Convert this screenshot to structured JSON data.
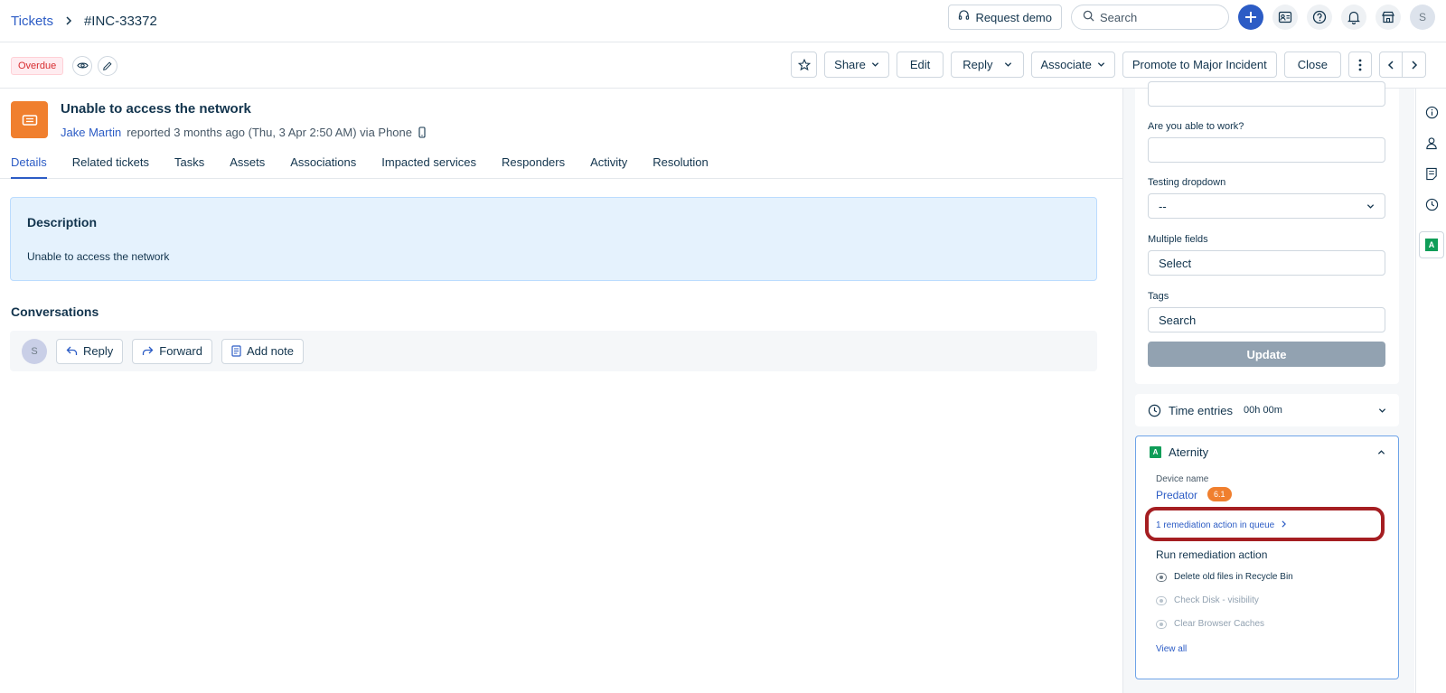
{
  "header": {
    "breadcrumb_root": "Tickets",
    "ticket_id": "#INC-33372",
    "request_demo": "Request demo",
    "search_placeholder": "Search",
    "avatar_initial": "S"
  },
  "actionbar": {
    "status_badge": "Overdue",
    "buttons": {
      "share": "Share",
      "edit": "Edit",
      "reply": "Reply",
      "associate": "Associate",
      "promote": "Promote to Major Incident",
      "close": "Close"
    }
  },
  "ticket": {
    "subject": "Unable to access the network",
    "reporter": "Jake Martin",
    "reported_text": "reported 3 months ago (Thu, 3 Apr 2:50 AM) via Phone"
  },
  "tabs": [
    "Details",
    "Related tickets",
    "Tasks",
    "Assets",
    "Associations",
    "Impacted services",
    "Responders",
    "Activity",
    "Resolution"
  ],
  "description": {
    "title": "Description",
    "text": "Unable to access the network"
  },
  "conversations": {
    "title": "Conversations",
    "avatar_initial": "S",
    "reply": "Reply",
    "forward": "Forward",
    "add_note": "Add note"
  },
  "right_panel": {
    "fields": {
      "able_to_work_label": "Are you able to work?",
      "testing_dropdown_label": "Testing dropdown",
      "testing_dropdown_value": "--",
      "multiple_fields_label": "Multiple fields",
      "multiple_fields_value": "Select",
      "tags_label": "Tags",
      "tags_placeholder": "Search"
    },
    "update_button": "Update",
    "time_entries": {
      "label": "Time entries",
      "value": "00h 00m"
    },
    "aternity": {
      "logo_letter": "A",
      "title": "Aternity",
      "device_label": "Device name",
      "device_name": "Predator",
      "device_score": "6.1",
      "queue_link": "1 remediation action in queue",
      "run_title": "Run remediation action",
      "actions": [
        {
          "label": "Delete old files in Recycle Bin",
          "enabled": true
        },
        {
          "label": "Check Disk - visibility",
          "enabled": false
        },
        {
          "label": "Clear Browser Caches",
          "enabled": false
        }
      ],
      "view_all": "View all"
    }
  },
  "rail": {
    "active_letter": "A"
  },
  "colors": {
    "accent": "#2c5cc5",
    "ticket_icon": "#f07f2e",
    "overdue": "#d72d30",
    "highlight": "#a51e22",
    "aternity_green": "#0f9d58"
  }
}
